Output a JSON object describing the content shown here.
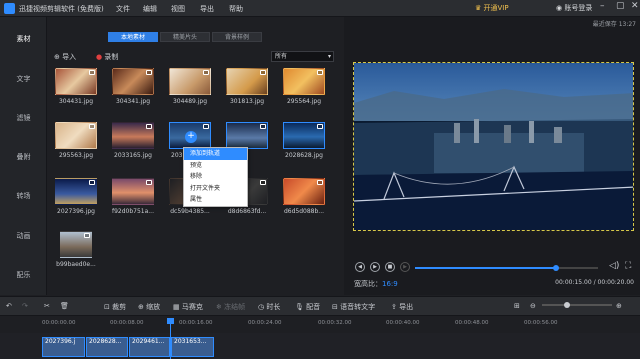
{
  "titlebar": {
    "app": "迅捷视频剪辑软件 (免费版)",
    "menu": [
      "文件",
      "编辑",
      "视图",
      "导出",
      "帮助"
    ],
    "vip": "开通VIP",
    "login": "账号登录"
  },
  "leftnav": [
    "素材",
    "文字",
    "滤镜",
    "叠附",
    "转场",
    "动画",
    "配乐"
  ],
  "tabs": [
    "本地素材",
    "精美片头",
    "背景样例"
  ],
  "tools": {
    "import": "导入",
    "record": "录制",
    "filter": "所有"
  },
  "files": [
    "304431.jpg",
    "304341.jpg",
    "304489.jpg",
    "301813.jpg",
    "295564.jpg",
    "295563.jpg",
    "2033165.jpg",
    "2031653.jpg",
    "",
    "2028628.jpg",
    "2027396.jpg",
    "f92d0b751a...",
    "dc59b4385...",
    "d8d6863fd...",
    "d6d5d088b...",
    "b99baed0e..."
  ],
  "context_menu": [
    "添加到轨道",
    "预览",
    "移除",
    "打开文件夹",
    "属性"
  ],
  "preview": {
    "autosave": "最近保存 13:27",
    "ratio_label": "宽高比：",
    "ratio_value": "16:9",
    "time": "00:00:15.00 / 00:00:20.00",
    "progress": 0.77
  },
  "toolbar": {
    "crop": "裁剪",
    "zoom": "缩放",
    "mosaic": "马赛克",
    "freeze": "冻结帧",
    "duration": "时长",
    "dub": "配音",
    "speech": "语音转文字",
    "export": "导出"
  },
  "ruler": [
    "00:00:00.00",
    "00:00:08.00",
    "00:00:16.00",
    "00:00:24.00",
    "00:00:32.00",
    "00:00:40.00",
    "00:00:48.00",
    "00:00:56.00"
  ],
  "clips": [
    "2027396.j",
    "2028628...",
    "2029461...",
    "2031653..."
  ],
  "zoom_level": 0.35
}
